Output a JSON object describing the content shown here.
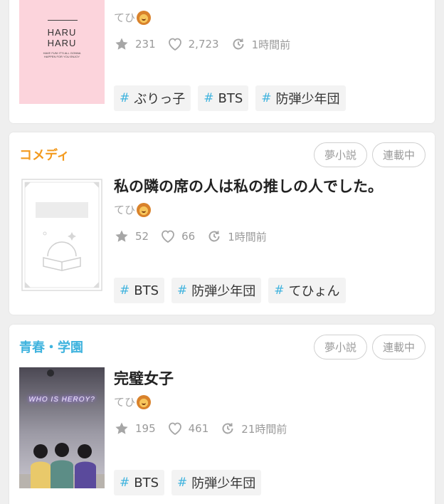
{
  "cards": [
    {
      "author": "てひ",
      "cover": {
        "line1": "HARU",
        "line2": "HARU",
        "small": "HAVE FUN! IT'S ALL GONNA HAPPEN FOR YOU ENJOY"
      },
      "stats": {
        "stars": "231",
        "likes": "2,723",
        "updated": "1時間前"
      },
      "tags": [
        "ぶりっ子",
        "BTS",
        "防弾少年団"
      ]
    },
    {
      "genre": "コメディ",
      "genre_color": "#f39a1e",
      "pills": [
        "夢小説",
        "連載中"
      ],
      "title": "私の隣の席の人は私の推しの人でした。",
      "author": "てひ",
      "stats": {
        "stars": "52",
        "likes": "66",
        "updated": "1時間前"
      },
      "tags": [
        "BTS",
        "防弾少年団",
        "てひょん"
      ]
    },
    {
      "genre": "青春・学園",
      "genre_color": "#3fb3de",
      "pills": [
        "夢小説",
        "連載中"
      ],
      "title": "完璧女子",
      "author": "てひ",
      "cover": {
        "neon": "WHO IS HEROY?"
      },
      "stats": {
        "stars": "195",
        "likes": "461",
        "updated": "21時間前"
      },
      "tags": [
        "BTS",
        "防弾少年団"
      ]
    }
  ],
  "tag_hash": "#",
  "icons": {
    "star": "star-icon",
    "like": "heart-icon",
    "updated": "clock-refresh-icon"
  }
}
